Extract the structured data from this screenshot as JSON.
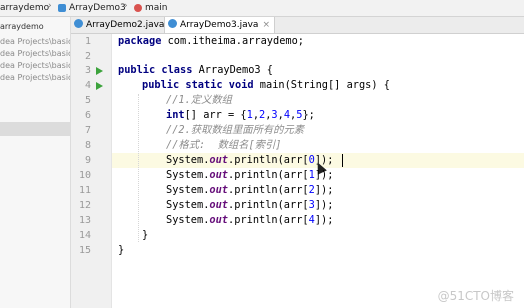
{
  "breadcrumb": {
    "project": "arraydemo",
    "file": "ArrayDemo3",
    "method": "main"
  },
  "project_tree": [
    "arraydemo",
    "dea Projects\\basic-code",
    "dea Projects\\basic-code",
    "dea Projects\\basic-code",
    "dea Projects\\basic-code"
  ],
  "tabs": [
    {
      "label": "ArrayDemo2.java",
      "active": false
    },
    {
      "label": "ArrayDemo3.java",
      "active": true
    }
  ],
  "line_numbers": [
    "1",
    "2",
    "3",
    "4",
    "5",
    "6",
    "7",
    "8",
    "9",
    "10",
    "11",
    "12",
    "13",
    "14",
    "15"
  ],
  "code": {
    "l1_kw": "package",
    "l1_rest": " com.itheima.arraydemo;",
    "l3_kw": "public class",
    "l3_rest": " ArrayDemo3 {",
    "l4_kw": "public static void",
    "l4_rest": " main(String[] args) {",
    "l5_cm": "//1.定义数组",
    "l6_kw": "int",
    "l6_a": "[] arr = {",
    "l6_n1": "1",
    "l6_n2": "2",
    "l6_n3": "3",
    "l6_n4": "4",
    "l6_n5": "5",
    "l6_end": "};",
    "l7_cm": "//2.获取数组里面所有的元素",
    "l8_cm": "//格式:  数组名[索引]",
    "print_pre": "System.",
    "print_out": "out",
    "print_mid": ".println(arr[",
    "print_end": "]);",
    "indexes": [
      "0",
      "1",
      "2",
      "3",
      "4"
    ],
    "close_method": "}",
    "close_class": "}"
  },
  "watermark": "@51CTO博客"
}
